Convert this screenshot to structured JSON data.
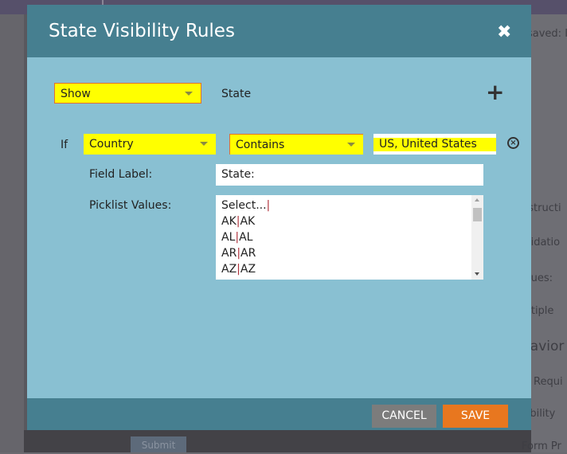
{
  "background": {
    "saved_text": "saved: I",
    "side_labels": [
      "nstructi",
      "alidatio",
      "alues:",
      "ultiple",
      "havior",
      "Requi",
      "sibility",
      "Form Pr"
    ],
    "submit_label": "Submit"
  },
  "dialog": {
    "title": "State Visibility Rules",
    "action_select": "Show",
    "field_name": "State",
    "condition": {
      "if_label": "If",
      "field": "Country",
      "operator": "Contains",
      "value": "US, United States"
    },
    "field_label_label": "Field Label:",
    "field_label_value": "State:",
    "picklist_label": "Picklist Values:",
    "picklist": [
      [
        "Select...",
        ""
      ],
      [
        "AK",
        "AK"
      ],
      [
        "AL",
        "AL"
      ],
      [
        "AR",
        "AR"
      ],
      [
        "AZ",
        "AZ"
      ]
    ],
    "cancel_label": "CANCEL",
    "save_label": "SAVE"
  },
  "colors": {
    "header": "#467f90",
    "body": "#89c0d2",
    "save": "#e8771f",
    "cancel": "#7c7c7c",
    "highlight": "#ffff00"
  }
}
